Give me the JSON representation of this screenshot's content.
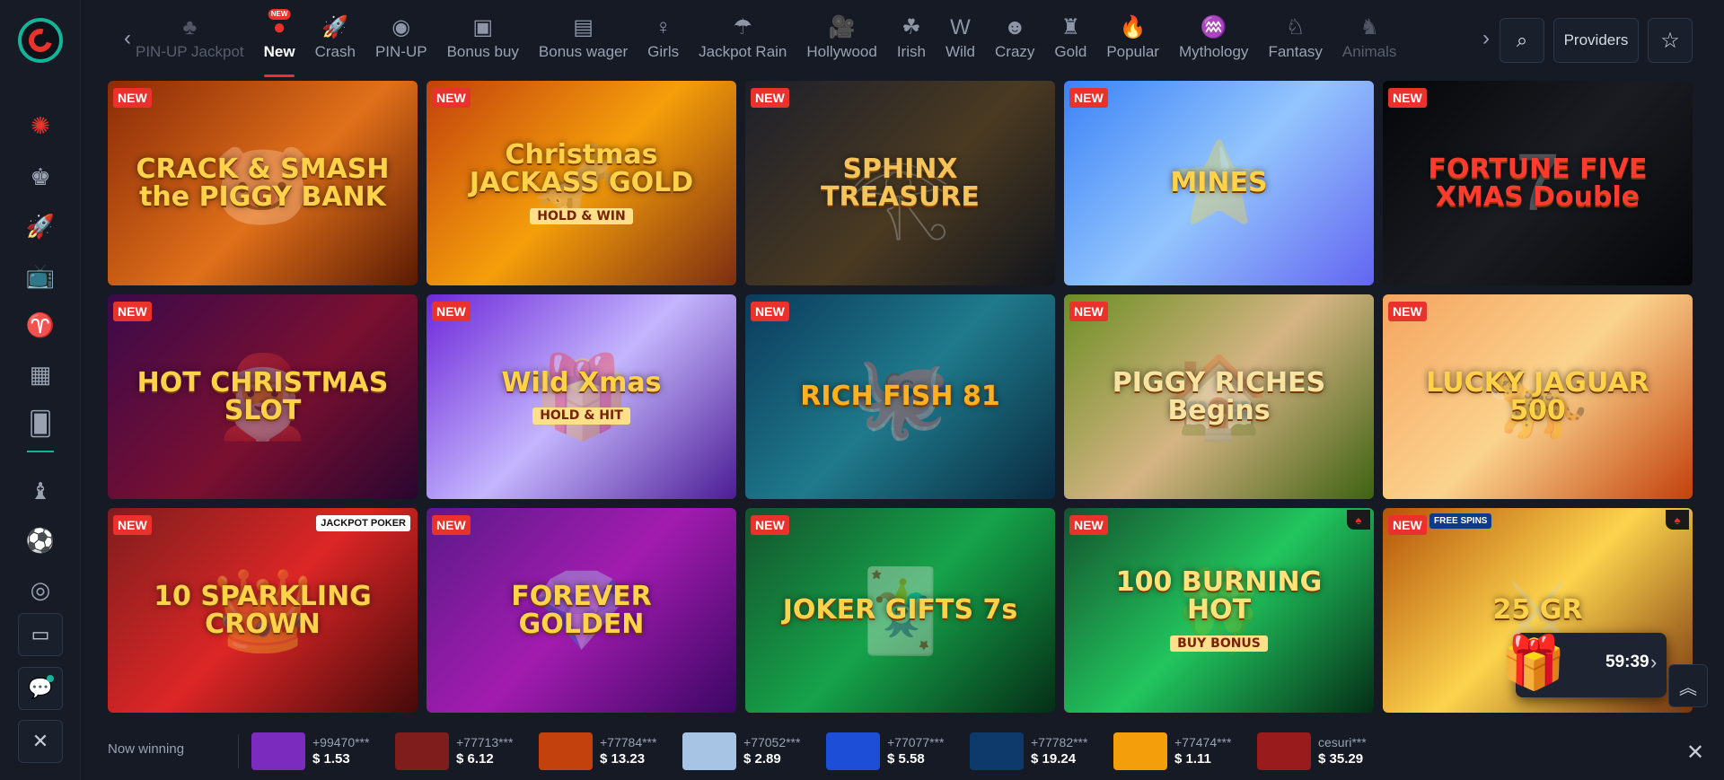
{
  "sidebar": {
    "logo_icon": "pin-up-logo",
    "items": [
      {
        "name": "casino-chip-icon",
        "glyph": "✺"
      },
      {
        "name": "live-dealer-icon",
        "glyph": "♚"
      },
      {
        "name": "rocket-icon",
        "glyph": "🚀"
      },
      {
        "name": "tv-games-icon",
        "glyph": "📺"
      },
      {
        "name": "aviator-icon",
        "glyph": "♈"
      },
      {
        "name": "bingo-icon",
        "glyph": "▦"
      },
      {
        "name": "cards-icon",
        "glyph": "🂠"
      },
      {
        "name": "esports-icon",
        "glyph": "♝"
      },
      {
        "name": "soccer-ball-icon",
        "glyph": "⚽"
      },
      {
        "name": "target-icon",
        "glyph": "◎"
      }
    ],
    "profile_icon": "id-card-icon",
    "chat_icon": "chat-icon",
    "language_icon": "uk-flag-icon"
  },
  "categories": [
    {
      "label": "PIN-UP Jackpot",
      "icon": "♣",
      "active": false
    },
    {
      "label": "New",
      "icon": "●",
      "active": true,
      "badge": "NEW"
    },
    {
      "label": "Crash",
      "icon": "🚀",
      "active": false
    },
    {
      "label": "PIN-UP",
      "icon": "◉",
      "active": false
    },
    {
      "label": "Bonus buy",
      "icon": "▣",
      "active": false
    },
    {
      "label": "Bonus wager",
      "icon": "▤",
      "active": false
    },
    {
      "label": "Girls",
      "icon": "♀",
      "active": false
    },
    {
      "label": "Jackpot Rain",
      "icon": "☂",
      "active": false
    },
    {
      "label": "Hollywood",
      "icon": "🎥",
      "active": false
    },
    {
      "label": "Irish",
      "icon": "☘",
      "active": false
    },
    {
      "label": "Wild",
      "icon": "W",
      "active": false
    },
    {
      "label": "Crazy",
      "icon": "☻",
      "active": false
    },
    {
      "label": "Gold",
      "icon": "♜",
      "active": false
    },
    {
      "label": "Popular",
      "icon": "🔥",
      "active": false
    },
    {
      "label": "Mythology",
      "icon": "♒",
      "active": false
    },
    {
      "label": "Fantasy",
      "icon": "♘",
      "active": false
    },
    {
      "label": "Animals",
      "icon": "♞",
      "active": false
    }
  ],
  "topbar": {
    "search_icon": "search-icon",
    "providers_label": "Providers",
    "favorites_icon": "star-icon"
  },
  "games": [
    {
      "title": "CRACK & SMASH the PIGGY BANK",
      "sub": "",
      "badge": "NEW",
      "bg": "linear-gradient(135deg,#8a2a08,#e0701a 55%,#5a1a04)",
      "deco": "🐷",
      "color": "#ffd24a"
    },
    {
      "title": "Christmas JACKASS GOLD",
      "sub": "HOLD & WIN",
      "badge": "NEW",
      "bg": "linear-gradient(135deg,#c2410c,#f59e0b 50%,#7c2d12)",
      "deco": "🫏",
      "color": "#ffd24a"
    },
    {
      "title": "SPHINX TREASURE",
      "sub": "",
      "badge": "NEW",
      "bg": "linear-gradient(135deg,#1c1f2a,#4a3a22 55%,#12151c)",
      "deco": "𓂀",
      "color": "#f4c35a"
    },
    {
      "title": "MINES",
      "sub": "",
      "badge": "NEW",
      "bg": "linear-gradient(135deg,#3b82f6,#93c5fd 50%,#6366f1)",
      "deco": "⭐",
      "color": "#ffd24a"
    },
    {
      "title": "FORTUNE FIVE XMAS Double",
      "sub": "",
      "badge": "NEW",
      "bg": "linear-gradient(135deg,#050608,#1a1c22 50%,#050608)",
      "deco": "7",
      "color": "#ff3b30"
    },
    {
      "title": "HOT CHRISTMAS SLOT",
      "sub": "",
      "badge": "NEW",
      "bg": "linear-gradient(135deg,#3b0a4a,#7a1030 55%,#2a0630)",
      "deco": "🎅",
      "color": "#ffd24a"
    },
    {
      "title": "Wild Xmas",
      "sub": "HOLD & HIT",
      "badge": "NEW",
      "bg": "linear-gradient(135deg,#6d28d9,#c4b5fd 50%,#4c1d95)",
      "deco": "🎁",
      "color": "#ffd24a"
    },
    {
      "title": "RICH FISH 81",
      "sub": "",
      "badge": "NEW",
      "bg": "linear-gradient(135deg,#0b3b5c,#1f7a8c 50%,#0a2a40)",
      "deco": "🐙",
      "color": "#ffb020"
    },
    {
      "title": "PIGGY RICHES Begins",
      "sub": "",
      "badge": "NEW",
      "bg": "linear-gradient(135deg,#6b8e23,#d4b483 50%,#3f6212)",
      "deco": "🏠",
      "color": "#f8e3a0"
    },
    {
      "title": "LUCKY JAGUAR 500",
      "sub": "",
      "badge": "NEW",
      "bg": "linear-gradient(135deg,#f4a460,#fbd38d 50%,#c2410c)",
      "deco": "🐆",
      "color": "#ffd24a"
    },
    {
      "title": "10 SPARKLING CROWN",
      "sub": "",
      "badge": "NEW",
      "bg": "linear-gradient(135deg,#7f1d1d,#dc2626 50%,#450a0a)",
      "deco": "👑",
      "color": "#ffd24a",
      "corner": "JACKPOT POKER"
    },
    {
      "title": "FOREVER GOLDEN",
      "sub": "",
      "badge": "NEW",
      "bg": "linear-gradient(135deg,#5b1a8a,#a21caf 50%,#3b0764)",
      "deco": "💎",
      "color": "#ffd24a"
    },
    {
      "title": "JOKER GIFTS 7s",
      "sub": "",
      "badge": "NEW",
      "bg": "linear-gradient(135deg,#14532d,#16a34a 50%,#052e16)",
      "deco": "🃏",
      "color": "#ffd24a"
    },
    {
      "title": "100 BURNING HOT",
      "sub": "BUY BONUS",
      "badge": "NEW",
      "bg": "linear-gradient(135deg,#14532d,#22c55e 50%,#052e16)",
      "deco": "🍀",
      "color": "#ffe27a",
      "suit": "♠"
    },
    {
      "title": "25 GR",
      "sub": "",
      "badge": "NEW",
      "bg": "linear-gradient(135deg,#b45309,#fcd34d 50%,#78350f)",
      "deco": "⚔",
      "color": "#ffd24a",
      "suit": "♠",
      "fs": "FREE SPINS"
    }
  ],
  "timer": {
    "value": "59:39",
    "icon": "gift-icon"
  },
  "winners": {
    "label": "Now winning",
    "items": [
      {
        "user": "+99470***",
        "amount": "$ 1.53",
        "color": "#7b2cbf"
      },
      {
        "user": "+77713***",
        "amount": "$ 6.12",
        "color": "#7f1d1d"
      },
      {
        "user": "+77784***",
        "amount": "$ 13.23",
        "color": "#c2410c"
      },
      {
        "user": "+77052***",
        "amount": "$ 2.89",
        "color": "#a7c4e5"
      },
      {
        "user": "+77077***",
        "amount": "$ 5.58",
        "color": "#1d4ed8"
      },
      {
        "user": "+77782***",
        "amount": "$ 19.24",
        "color": "#0e3a6b"
      },
      {
        "user": "+77474***",
        "amount": "$ 1.11",
        "color": "#f59e0b"
      },
      {
        "user": "cesuri***",
        "amount": "$ 35.29",
        "color": "#991b1b"
      }
    ]
  }
}
